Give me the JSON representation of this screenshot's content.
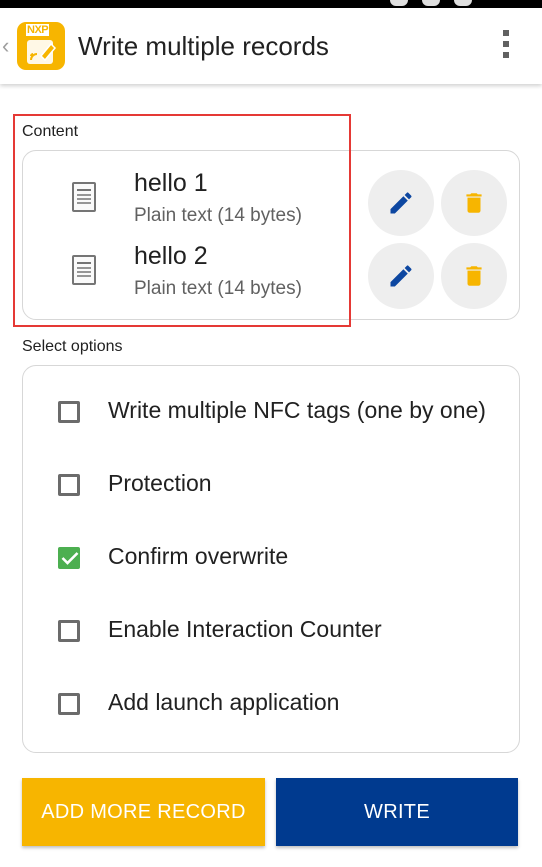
{
  "app_bar": {
    "title": "Write multiple records",
    "logo_text": "NXP",
    "icons": [
      "back-caret-icon",
      "nfc-tag-writer-logo",
      "overflow-menu-icon"
    ]
  },
  "content": {
    "label": "Content",
    "records": [
      {
        "title": "hello 1",
        "subtitle": "Plain text (14 bytes)",
        "icon": "text-document-icon"
      },
      {
        "title": "hello 2",
        "subtitle": "Plain text (14 bytes)",
        "icon": "text-document-icon"
      }
    ],
    "record_actions": [
      "pencil-icon",
      "trash-icon"
    ]
  },
  "options": {
    "label": "Select options",
    "items": [
      {
        "label": "Write multiple NFC tags (one by one)",
        "checked": false
      },
      {
        "label": "Protection",
        "checked": false
      },
      {
        "label": "Confirm overwrite",
        "checked": true
      },
      {
        "label": "Enable Interaction Counter",
        "checked": false
      },
      {
        "label": "Add launch application",
        "checked": false
      }
    ]
  },
  "buttons": {
    "add_more": "ADD MORE RECORD",
    "write": "WRITE"
  },
  "colors": {
    "accent_yellow": "#f7b500",
    "primary_blue": "#003a8f",
    "edit_icon_blue": "#0d47a1",
    "check_green": "#4caf50",
    "highlight_red": "#e53935"
  }
}
